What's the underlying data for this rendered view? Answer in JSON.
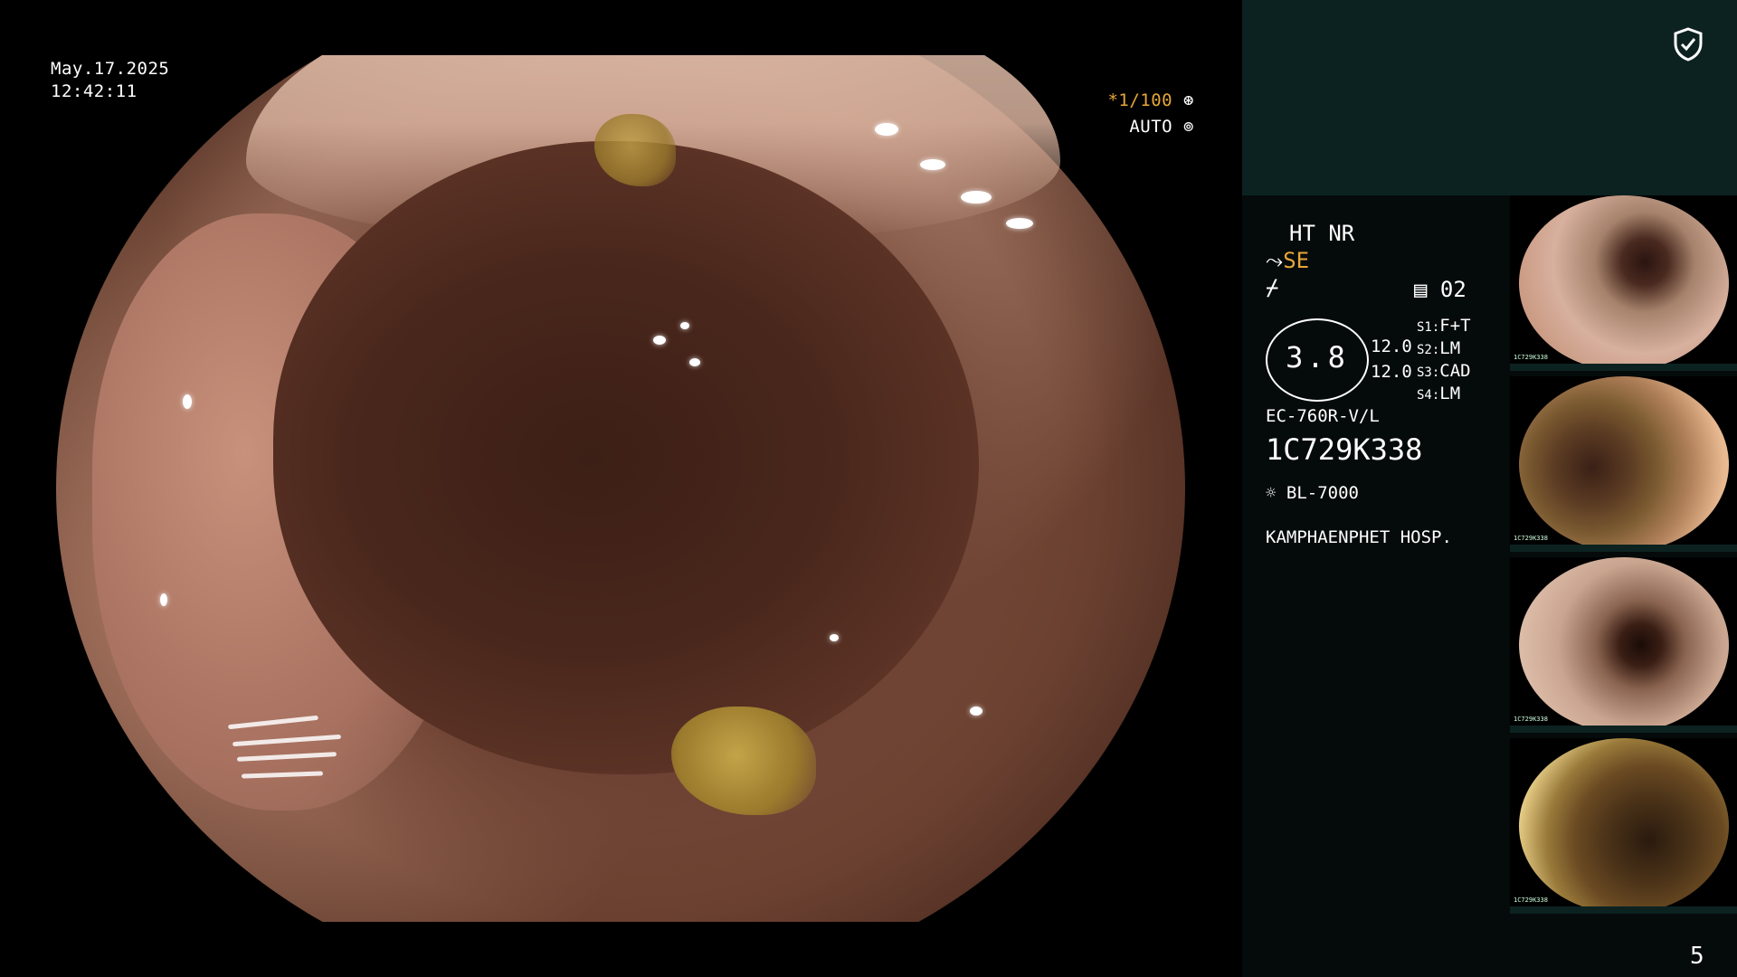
{
  "overlay": {
    "date": "May.17.2025",
    "time": "12:42:11",
    "shutter": "*1/100",
    "iris_mode": "AUTO"
  },
  "panel": {
    "mode_line": "HT NR",
    "se_label": "SE",
    "image_count": "02",
    "circle_value": "3.8",
    "values": [
      "12.0",
      "12.0"
    ],
    "s_labels": [
      {
        "key": "S1:",
        "val": "F+T"
      },
      {
        "key": "S2:",
        "val": "LM"
      },
      {
        "key": "S3:",
        "val": "CAD"
      },
      {
        "key": "S4:",
        "val": "LM"
      }
    ],
    "scope_model": "EC-760R-V/L",
    "serial": "1C729K338",
    "light_source": "BL-7000",
    "hospital": "KAMPHAENPHET HOSP.",
    "page": "5"
  },
  "thumbnails": [
    {
      "label": "1C729K338"
    },
    {
      "label": "1C729K338"
    },
    {
      "label": "1C729K338"
    },
    {
      "label": "1C729K338"
    }
  ],
  "colors": {
    "panel_bg": "#050b0a",
    "panel_top_bg": "#0c2221",
    "accent_orange": "#e6a63a"
  },
  "icons": [
    "shield-check-icon",
    "shutter-icon",
    "iris-icon",
    "scope-icon",
    "freeze-icon",
    "image-list-icon",
    "lamp-icon"
  ]
}
